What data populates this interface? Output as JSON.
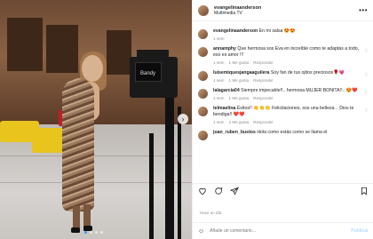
{
  "post": {
    "username": "evangelinaanderson",
    "subtitle": "Multimedia TV",
    "caption": {
      "username": "evangelinaanderson",
      "text": "En mi salsa 😍😍",
      "time": "1 sem"
    }
  },
  "camera_label": "Bandy",
  "comments": [
    {
      "username": "annamphy",
      "text": "Que hermosa sos Eva en increíble como te adaptás a todo, eso es amor !!!",
      "time": "1 sem",
      "likes": "1 Me gusta",
      "reply": "Responder"
    },
    {
      "username": "luisemiquesjangaaguilera",
      "text": "Soy fan de tus ojitos preciosos🌹💗",
      "time": "1 sem",
      "likes": "1 Me gusta",
      "reply": "Responder"
    },
    {
      "username": "lalagarcia04",
      "text": "Siempre impecable!!.. hermosa MUJER BONITA!!.. 😍❤️",
      "time": "1 sem",
      "likes": "1 Me gusta",
      "reply": "Responder"
    },
    {
      "username": "telmaelina",
      "text": "Éxitos!! 👏👏👏 Felicitaciones, sos una belleza .. Dios te bendiga!! ❤️❤️",
      "time": "1 sem",
      "likes": "2 Me gusta",
      "reply": "Responder"
    },
    {
      "username": "juan_ruben_bustos",
      "text": "Hola como estás como se llama el",
      "time": "",
      "likes": "",
      "reply": ""
    }
  ],
  "time_ago": "Hace un día",
  "add_comment": {
    "placeholder": "Añade un comentario...",
    "publish": "Publicar"
  },
  "icons": {
    "more": "more-icon",
    "heart": "heart-icon",
    "comment": "comment-icon",
    "share": "share-icon",
    "save": "bookmark-icon",
    "emoji": "emoji-icon",
    "next": "chevron-right-icon"
  },
  "colors": {
    "accent": "#3897f0",
    "muted": "#8e8e8e",
    "text": "#262626"
  }
}
